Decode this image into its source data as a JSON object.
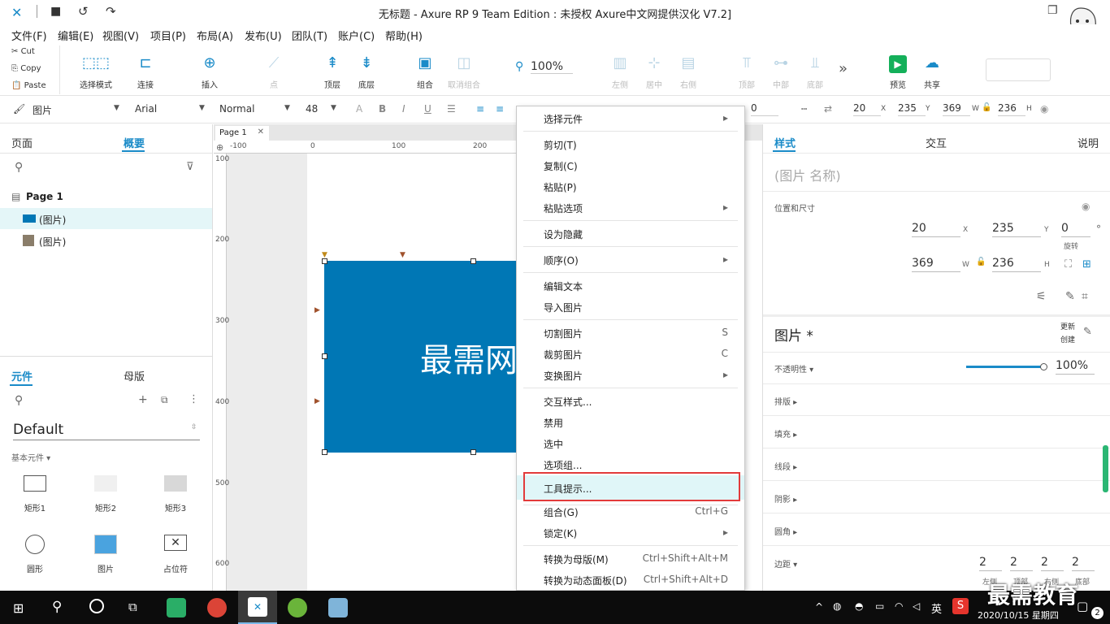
{
  "titlebar": {
    "title": "无标题 - Axure RP 9 Team Edition : 未授权     Axure中文网提供汉化 V7.2]"
  },
  "menu": [
    "文件(F)",
    "编辑(E)",
    "视图(V)",
    "项目(P)",
    "布局(A)",
    "发布(U)",
    "团队(T)",
    "账户(C)",
    "帮助(H)"
  ],
  "clipboard": {
    "cut": "Cut",
    "copy": "Copy",
    "paste": "Paste"
  },
  "toolbar": {
    "select_mode": "选择模式",
    "connect": "连接",
    "insert": "插入",
    "point": "点",
    "top_layer": "顶层",
    "bottom_layer": "底层",
    "group": "组合",
    "ungroup": "取消组合",
    "zoom": "100%",
    "align_left": "左侧",
    "align_center": "居中",
    "align_right": "右侧",
    "align_top": "顶部",
    "align_middle": "中部",
    "align_bottom": "底部",
    "more": "»",
    "preview": "预览",
    "share": "共享"
  },
  "formatbar": {
    "widget_type": "图片",
    "font": "Arial",
    "style": "Normal",
    "size": "48",
    "rotation": "0",
    "x": "20",
    "y": "235",
    "w": "369",
    "h": "236",
    "x_label": "X",
    "y_label": "Y",
    "w_label": "W",
    "h_label": "H"
  },
  "leftpanel": {
    "tab_pages": "页面",
    "tab_outline": "概要",
    "page_name": "Page 1",
    "items": [
      "(图片)",
      "(图片)"
    ],
    "tab_widgets": "元件",
    "tab_masters": "母版",
    "library": "Default",
    "category": "基本元件 ▾",
    "widgets": [
      "矩形1",
      "矩形2",
      "矩形3",
      "圆形",
      "图片",
      "占位符"
    ]
  },
  "canvas": {
    "tab": "Page 1",
    "ruler_h": [
      "-100",
      "0",
      "100",
      "200"
    ],
    "ruler_v": [
      "100",
      "200",
      "300",
      "400",
      "500",
      "600"
    ],
    "image_text": "最需网"
  },
  "context_menu": {
    "items": [
      {
        "label": "选择元件",
        "shortcut": "",
        "arrow": true
      },
      {
        "label": "剪切(T)",
        "shortcut": "",
        "arrow": false
      },
      {
        "label": "复制(C)",
        "shortcut": "",
        "arrow": false
      },
      {
        "label": "粘贴(P)",
        "shortcut": "",
        "arrow": false
      },
      {
        "label": "粘贴选项",
        "shortcut": "",
        "arrow": true
      },
      {
        "label": "设为隐藏",
        "shortcut": "",
        "arrow": false
      },
      {
        "label": "顺序(O)",
        "shortcut": "",
        "arrow": true
      },
      {
        "label": "编辑文本",
        "shortcut": "",
        "arrow": false
      },
      {
        "label": "导入图片",
        "shortcut": "",
        "arrow": false
      },
      {
        "label": "切割图片",
        "shortcut": "S",
        "arrow": false
      },
      {
        "label": "裁剪图片",
        "shortcut": "C",
        "arrow": false
      },
      {
        "label": "变换图片",
        "shortcut": "",
        "arrow": true
      },
      {
        "label": "交互样式...",
        "shortcut": "",
        "arrow": false
      },
      {
        "label": "禁用",
        "shortcut": "",
        "arrow": false
      },
      {
        "label": "选中",
        "shortcut": "",
        "arrow": false
      },
      {
        "label": "选项组...",
        "shortcut": "",
        "arrow": false
      },
      {
        "label": "工具提示...",
        "shortcut": "",
        "arrow": false
      },
      {
        "label": "组合(G)",
        "shortcut": "Ctrl+G",
        "arrow": false
      },
      {
        "label": "锁定(K)",
        "shortcut": "",
        "arrow": true
      },
      {
        "label": "转换为母版(M)",
        "shortcut": "Ctrl+Shift+Alt+M",
        "arrow": false
      },
      {
        "label": "转换为动态面板(D)",
        "shortcut": "Ctrl+Shift+Alt+D",
        "arrow": false
      }
    ]
  },
  "rightpanel": {
    "tab_style": "样式",
    "tab_interaction": "交互",
    "tab_notes": "说明",
    "name_placeholder": "(图片 名称)",
    "pos_size": "位置和尺寸",
    "x": "20",
    "y": "235",
    "rotation": "0",
    "rotation_unit": "°",
    "rotation_label": "旋转",
    "w": "369",
    "h": "236",
    "x_label": "X",
    "y_label": "Y",
    "w_label": "W",
    "h_label": "H",
    "style_name": "图片 *",
    "update": "更新",
    "create": "创建",
    "opacity_label": "不透明性 ▾",
    "opacity": "100%",
    "opacity_fraction": 1.0,
    "sections": [
      "排版 ▸",
      "填充 ▸",
      "线段 ▸",
      "阴影 ▸",
      "圆角 ▸"
    ],
    "padding_label": "边距 ▾",
    "padding": [
      "2",
      "2",
      "2",
      "2"
    ],
    "padding_labels": [
      "左侧",
      "顶部",
      "右侧",
      "底部"
    ]
  },
  "taskbar": {
    "ime": "英",
    "date": "2020/10/15 星期四",
    "time": "9:",
    "notif": "2",
    "watermark": "最需教育"
  },
  "colors": {
    "accent": "#1a8bc8",
    "image_fill": "#0077b5",
    "highlight_box": "#e23b3b"
  }
}
